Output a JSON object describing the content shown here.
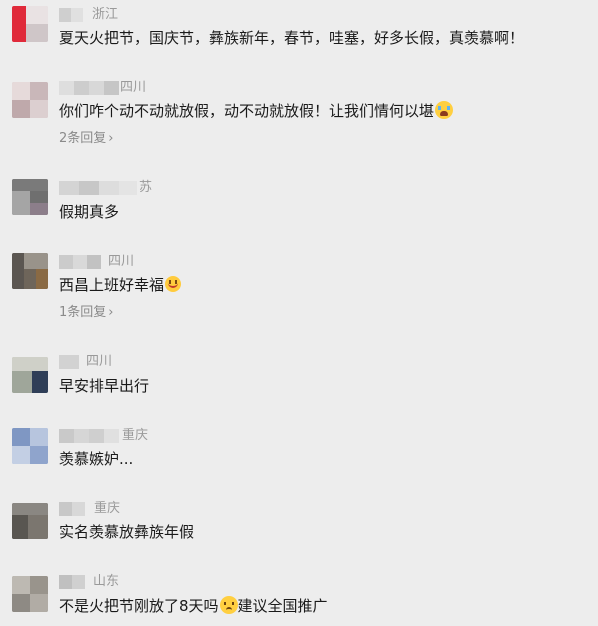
{
  "comments": [
    {
      "location": "浙江",
      "text": "夏天火把节，国庆节，彝族新年，春节，哇塞，好多长假，真羡慕啊！"
    },
    {
      "location": "四川",
      "text": "你们咋个动不动就放假，动不动就放假！让我们情何以堪",
      "emoji": "crying-face-emoji",
      "reply_count": "2条回复"
    },
    {
      "location": "苏",
      "text": "假期真多"
    },
    {
      "location": "四川",
      "text": "西昌上班好幸福",
      "emoji": "smiling-face-emoji",
      "reply_count": "1条回复"
    },
    {
      "location": "四川",
      "text": "早安排早出行"
    },
    {
      "location": "重庆",
      "text": "羡慕嫉妒..."
    },
    {
      "location": "重庆",
      "text": "实名羡慕放彝族年假"
    },
    {
      "location": "山东",
      "text_before": "不是火把节刚放了8天吗",
      "emoji": "sad-face-emoji",
      "text_after": "建议全国推广"
    }
  ],
  "reply_chevron": "›",
  "colors": {
    "background": "#ededed",
    "text": "#1a1a1a",
    "meta": "#9a9a9a",
    "reply": "#8a8a8a"
  }
}
